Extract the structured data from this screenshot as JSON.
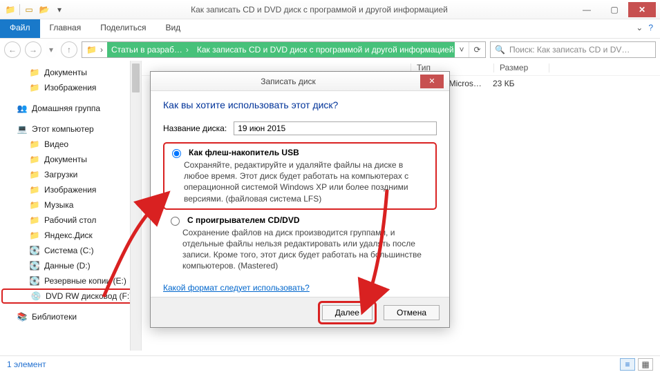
{
  "window": {
    "title": "Как записать CD и DVD диск с программой и другой информацией"
  },
  "ribbon": {
    "file": "Файл",
    "tabs": [
      "Главная",
      "Поделиться",
      "Вид"
    ]
  },
  "breadcrumb": {
    "items": [
      "Статьи в разраб…",
      "Как записать CD и DVD диск с программой и другой информацией"
    ]
  },
  "search": {
    "placeholder": "Поиск: Как записать CD и DV…"
  },
  "tree": {
    "quick": [
      "Документы",
      "Изображения"
    ],
    "homegroup": "Домашняя группа",
    "thispc": "Этот компьютер",
    "thispc_children": [
      {
        "label": "Видео",
        "icon": "📁"
      },
      {
        "label": "Документы",
        "icon": "📁"
      },
      {
        "label": "Загрузки",
        "icon": "📁"
      },
      {
        "label": "Изображения",
        "icon": "📁"
      },
      {
        "label": "Музыка",
        "icon": "📁"
      },
      {
        "label": "Рабочий стол",
        "icon": "📁"
      },
      {
        "label": "Яндекс.Диск",
        "icon": "📁"
      },
      {
        "label": "Система (C:)",
        "icon": "💽"
      },
      {
        "label": "Данные (D:)",
        "icon": "💽"
      },
      {
        "label": "Резервные копии (E:)",
        "icon": "💽"
      },
      {
        "label": "DVD RW дисковод (F:)",
        "icon": "💿",
        "highlight": true
      }
    ],
    "libraries": "Библиотеки"
  },
  "columns": {
    "c1": "Тип",
    "c2": "Размер"
  },
  "filerow": {
    "type": "Документ Micros…",
    "size": "23 КБ"
  },
  "status": {
    "text": "1 элемент"
  },
  "dialog": {
    "title": "Записать диск",
    "heading": "Как вы хотите использовать этот диск?",
    "name_label": "Название диска:",
    "name_value": "19 июн 2015",
    "opt1_title": "Как флеш-накопитель USB",
    "opt1_desc": "Сохраняйте, редактируйте и удаляйте файлы на диске в любое время. Этот диск будет работать на компьютерах с операционной системой Windows XP или более поздними версиями. (файловая система LFS)",
    "opt2_title": "С проигрывателем CD/DVD",
    "opt2_desc": "Сохранение файлов на диск производится группами, и отдельные файлы нельзя редактировать или удалять после записи. Кроме того, этот диск будет работать на большинстве компьютеров. (Mastered)",
    "link": "Какой формат следует использовать?",
    "next": "Далее",
    "cancel": "Отмена"
  }
}
